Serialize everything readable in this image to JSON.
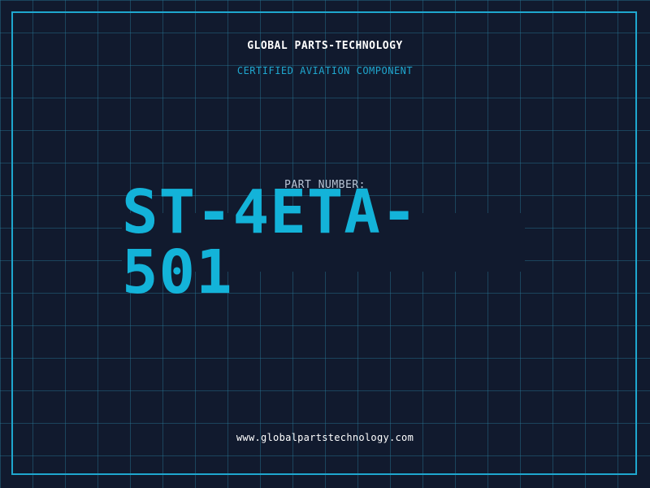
{
  "header": {
    "brand": "GLOBAL PARTS-TECHNOLOGY",
    "tagline": "CERTIFIED AVIATION COMPONENT"
  },
  "part": {
    "label": "PART NUMBER:",
    "number": "ST-4ETA-501"
  },
  "footer": {
    "website": "www.globalpartstechnology.com"
  },
  "colors": {
    "background": "#111a2e",
    "grid": "#287896",
    "accent": "#1fa7cf",
    "part_number": "#13b3d9",
    "text_primary": "#ffffff",
    "text_muted": "#b8c4d4"
  }
}
